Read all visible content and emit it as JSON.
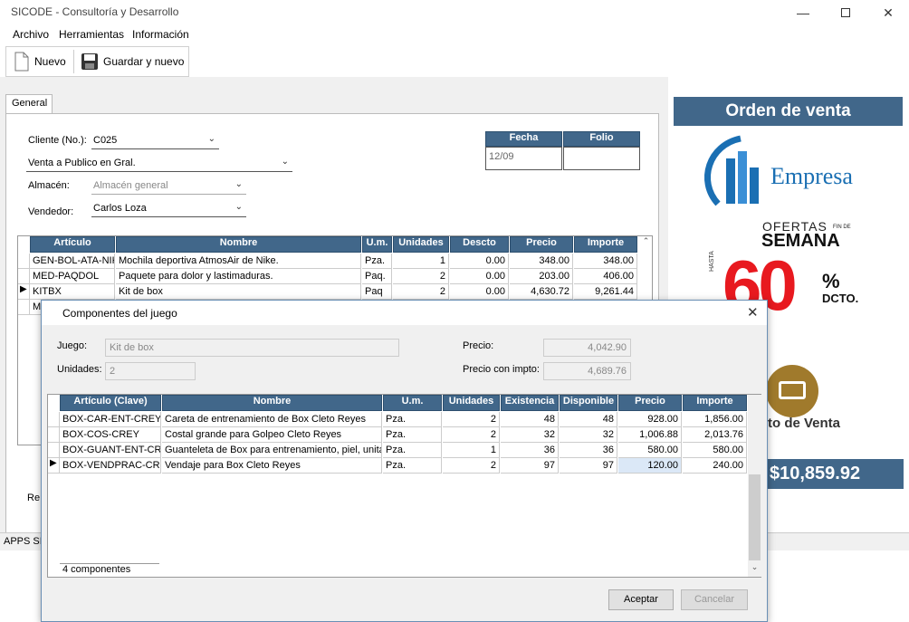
{
  "window": {
    "title": "SICODE - Consultoría y Desarrollo"
  },
  "menu": [
    "Archivo",
    "Herramientas",
    "Información"
  ],
  "toolbar": {
    "new_label": "Nuevo",
    "save_new_label": "Guardar y nuevo"
  },
  "tabs": [
    "General"
  ],
  "form": {
    "cliente_label": "Cliente (No.):",
    "cliente_value": "C025",
    "cliente_name": "Venta a Publico en Gral.",
    "almacen_label": "Almacén:",
    "almacen_value": "Almacén general",
    "vendedor_label": "Vendedor:",
    "vendedor_value": "Carlos Loza",
    "fecha_label": "Fecha",
    "fecha_value": "12/09",
    "folio_label": "Folio",
    "folio_value": "",
    "re_fragment": "Re"
  },
  "main_grid": {
    "headers": [
      "Artículo",
      "Nombre",
      "U.m.",
      "Unidades",
      "Descto",
      "Precio",
      "Importe"
    ],
    "rows": [
      [
        "GEN-BOL-ATA-NIK",
        "Mochila deportiva AtmosAir de Nike.",
        "Pza.",
        "1",
        "0.00",
        "348.00",
        "348.00"
      ],
      [
        "MED-PAQDOL",
        "Paquete para dolor y lastimaduras.",
        "Paq.",
        "2",
        "0.00",
        "203.00",
        "406.00"
      ],
      [
        "KITBX",
        "Kit de box",
        "Paq",
        "2",
        "0.00",
        "4,630.72",
        "9,261.44"
      ],
      [
        "ME",
        "",
        "",
        "",
        "",
        "",
        ""
      ]
    ]
  },
  "right_panel": {
    "order_title": "Orden de venta",
    "company": "Empresa",
    "promo_top": "OFERTAS",
    "promo_fin": "FIN DE",
    "promo_week": "SEMANA",
    "promo_hasta": "HASTA",
    "promo_pct": "60",
    "promo_pct_sign": "%",
    "promo_dcto": "DCTO.",
    "pos_label": "to de Venta",
    "total": "$10,859.92"
  },
  "status": {
    "text": "APPS SIC"
  },
  "dialog": {
    "title": "Componentes del juego",
    "juego_label": "Juego:",
    "juego_value": "Kit de box",
    "unidades_label": "Unidades:",
    "unidades_value": "2",
    "precio_label": "Precio:",
    "precio_value": "4,042.90",
    "precio_impto_label": "Precio con impto:",
    "precio_impto_value": "4,689.76",
    "grid_headers": [
      "Artículo (Clave)",
      "Nombre",
      "U.m.",
      "Unidades",
      "Existencia",
      "Disponible",
      "Precio",
      "Importe"
    ],
    "grid_rows": [
      [
        "BOX-CAR-ENT-CREY",
        "Careta de entrenamiento de Box Cleto Reyes",
        "Pza.",
        "2",
        "48",
        "48",
        "928.00",
        "1,856.00"
      ],
      [
        "BOX-COS-CREY",
        "Costal grande para Golpeo Cleto Reyes",
        "Pza.",
        "2",
        "32",
        "32",
        "1,006.88",
        "2,013.76"
      ],
      [
        "BOX-GUANT-ENT-CREY",
        "Guanteleta de Box para entrenamiento, piel, unitalla",
        "Pza.",
        "1",
        "36",
        "36",
        "580.00",
        "580.00"
      ],
      [
        "BOX-VENDPRAC-CREY",
        "Vendaje para Box Cleto Reyes",
        "Pza.",
        "2",
        "97",
        "97",
        "120.00",
        "240.00"
      ]
    ],
    "footer_count": "4 componentes",
    "accept_label": "Aceptar",
    "cancel_label": "Cancelar"
  }
}
